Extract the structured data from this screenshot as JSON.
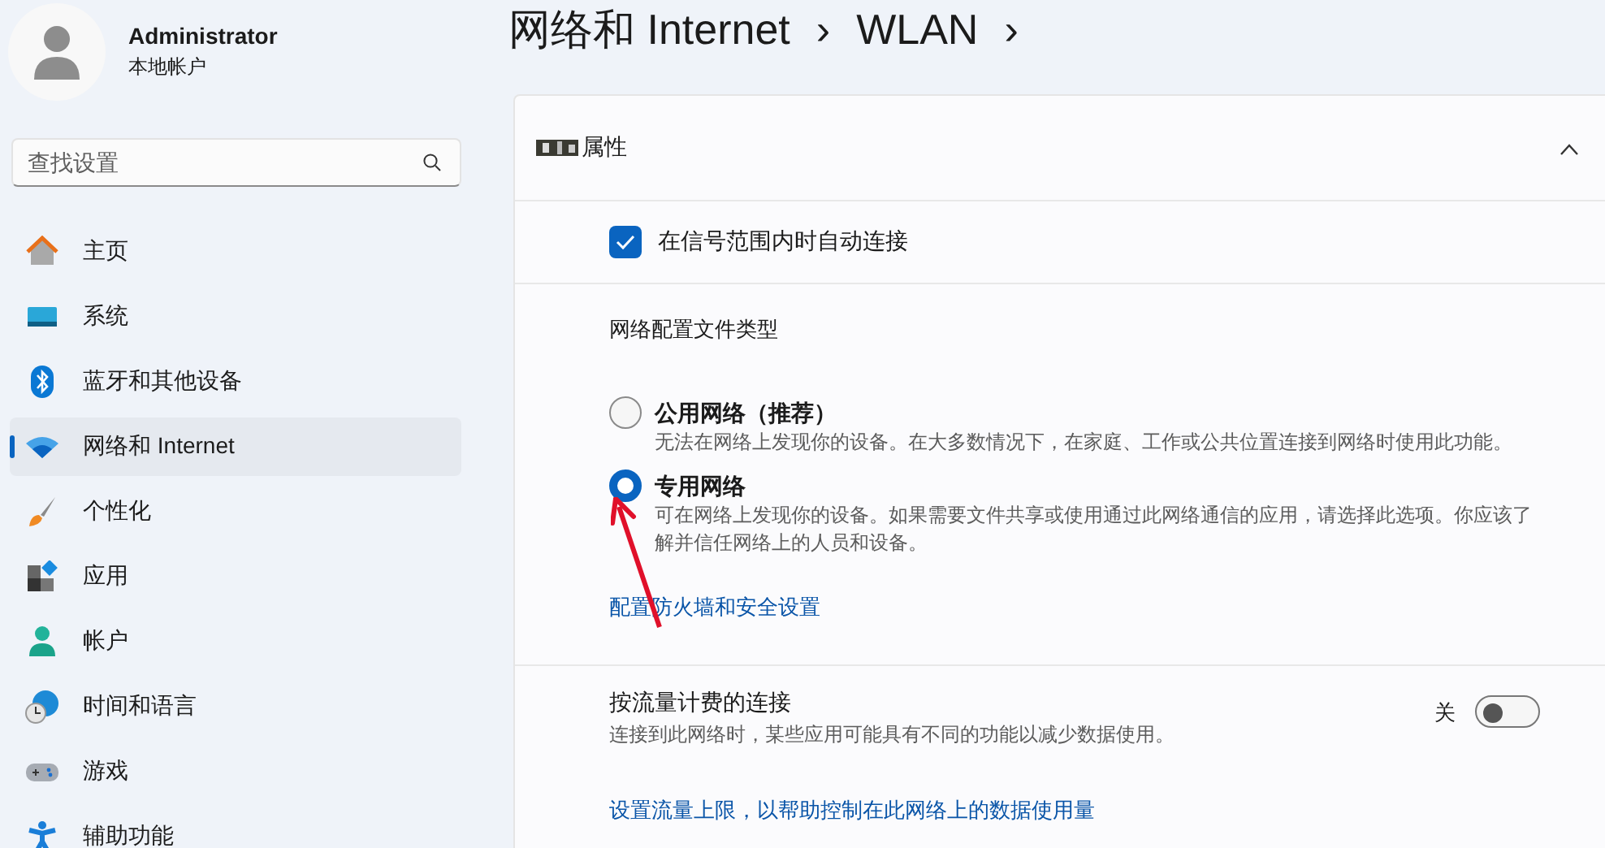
{
  "account": {
    "name": "Administrator",
    "type": "本地帐户"
  },
  "search": {
    "placeholder": "查找设置"
  },
  "nav": [
    {
      "label": "主页",
      "selected": false
    },
    {
      "label": "系统",
      "selected": false
    },
    {
      "label": "蓝牙和其他设备",
      "selected": false
    },
    {
      "label": "网络和 Internet",
      "selected": true
    },
    {
      "label": "个性化",
      "selected": false
    },
    {
      "label": "应用",
      "selected": false
    },
    {
      "label": "帐户",
      "selected": false
    },
    {
      "label": "时间和语言",
      "selected": false
    },
    {
      "label": "游戏",
      "selected": false
    },
    {
      "label": "辅助功能",
      "selected": false
    }
  ],
  "breadcrumb": {
    "separator": "›",
    "items": [
      "网络和 Internet",
      "WLAN"
    ]
  },
  "section": {
    "title": "属性",
    "expanded": true,
    "auto_connect": {
      "label": "在信号范围内时自动连接",
      "checked": true
    },
    "profile": {
      "heading": "网络配置文件类型",
      "options": [
        {
          "label": "公用网络（推荐）",
          "description": "无法在网络上发现你的设备。在大多数情况下，在家庭、工作或公共位置连接到网络时使用此功能。",
          "selected": false
        },
        {
          "label": "专用网络",
          "description": "可在网络上发现你的设备。如果需要文件共享或使用通过此网络通信的应用，请选择此选项。你应该了解并信任网络上的人员和设备。",
          "selected": true
        }
      ],
      "link": "配置防火墙和安全设置"
    },
    "metered": {
      "title": "按流量计费的连接",
      "description": "连接到此网络时，某些应用可能具有不同的功能以减少数据使用。",
      "state_label": "关",
      "on": false,
      "link": "设置流量上限，以帮助控制在此网络上的数据使用量"
    }
  }
}
